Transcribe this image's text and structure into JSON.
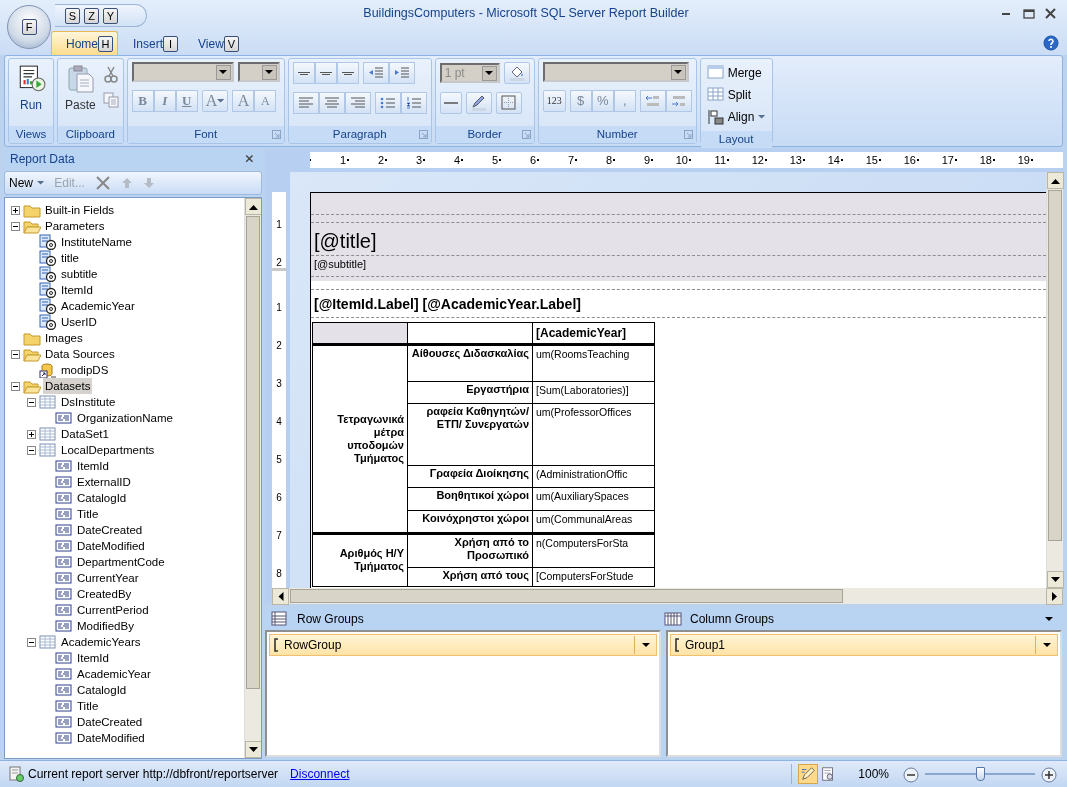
{
  "window": {
    "title": "BuildingsComputers - Microsoft SQL Server Report Builder",
    "orb_keytip": "F",
    "quick_access_keytips": [
      "S",
      "Z",
      "Y"
    ]
  },
  "tabs": [
    {
      "label": "Home",
      "keytip": "H",
      "selected": true
    },
    {
      "label": "Insert",
      "keytip": "I",
      "selected": false
    },
    {
      "label": "View",
      "keytip": "V",
      "selected": false
    }
  ],
  "ribbon": {
    "groups": [
      {
        "kind": "views",
        "label": "Views",
        "launcher": false,
        "buttons": [
          "Run"
        ]
      },
      {
        "kind": "clipboard",
        "label": "Clipboard",
        "launcher": false,
        "buttons": [
          "Paste"
        ]
      },
      {
        "kind": "font",
        "label": "Font",
        "launcher": true,
        "buttons": [
          "B",
          "I",
          "U",
          "A",
          "A",
          "A"
        ]
      },
      {
        "kind": "paragraph",
        "label": "Paragraph",
        "launcher": true
      },
      {
        "kind": "border",
        "label": "Border",
        "launcher": true,
        "combo": "1 pt"
      },
      {
        "kind": "number",
        "label": "Number",
        "launcher": true,
        "buttons": [
          "123",
          "$",
          "%",
          ","
        ]
      },
      {
        "kind": "layout",
        "label": "Layout",
        "launcher": false,
        "buttons": [
          "Merge",
          "Split",
          "Align"
        ]
      }
    ]
  },
  "report_data": {
    "title": "Report Data",
    "toolbar": [
      {
        "kind": "new",
        "label": "New",
        "disabled": false
      },
      {
        "kind": "edit",
        "label": "Edit...",
        "disabled": true
      },
      {
        "kind": "delete",
        "disabled": false
      },
      {
        "kind": "up",
        "disabled": true
      },
      {
        "kind": "down",
        "disabled": true
      }
    ],
    "tree": [
      {
        "label": "Built-in Fields",
        "kind": "folder",
        "expanded": false,
        "selected": false
      },
      {
        "label": "Parameters",
        "kind": "folder",
        "expanded": true,
        "selected": false,
        "children": [
          {
            "label": "InstituteName",
            "kind": "parameter",
            "selected": false
          },
          {
            "label": "title",
            "kind": "parameter",
            "selected": false
          },
          {
            "label": "subtitle",
            "kind": "parameter",
            "selected": false
          },
          {
            "label": "ItemId",
            "kind": "parameter",
            "selected": false
          },
          {
            "label": "AcademicYear",
            "kind": "parameter",
            "selected": false
          },
          {
            "label": "UserID",
            "kind": "parameter",
            "selected": false
          }
        ]
      },
      {
        "label": "Images",
        "kind": "folder",
        "selected": false
      },
      {
        "label": "Data Sources",
        "kind": "folder",
        "expanded": true,
        "selected": false,
        "children": [
          {
            "label": "modipDS",
            "kind": "datasource",
            "selected": false
          }
        ]
      },
      {
        "label": "Datasets",
        "kind": "folder",
        "expanded": true,
        "selected": true,
        "children": [
          {
            "label": "DsInstitute",
            "kind": "dataset",
            "expanded": true,
            "selected": false,
            "children": [
              {
                "label": "OrganizationName",
                "kind": "field",
                "selected": false
              }
            ]
          },
          {
            "label": "DataSet1",
            "kind": "dataset",
            "expanded": false,
            "selected": false
          },
          {
            "label": "LocalDepartments",
            "kind": "dataset",
            "expanded": true,
            "selected": false,
            "children": [
              {
                "label": "ItemId",
                "kind": "field",
                "selected": false
              },
              {
                "label": "ExternalID",
                "kind": "field",
                "selected": false
              },
              {
                "label": "CatalogId",
                "kind": "field",
                "selected": false
              },
              {
                "label": "Title",
                "kind": "field",
                "selected": false
              },
              {
                "label": "DateCreated",
                "kind": "field",
                "selected": false
              },
              {
                "label": "DateModified",
                "kind": "field",
                "selected": false
              },
              {
                "label": "DepartmentCode",
                "kind": "field",
                "selected": false
              },
              {
                "label": "CurrentYear",
                "kind": "field",
                "selected": false
              },
              {
                "label": "CreatedBy",
                "kind": "field",
                "selected": false
              },
              {
                "label": "CurrentPeriod",
                "kind": "field",
                "selected": false
              },
              {
                "label": "ModifiedBy",
                "kind": "field",
                "selected": false
              }
            ]
          },
          {
            "label": "AcademicYears",
            "kind": "dataset",
            "expanded": true,
            "selected": false,
            "children": [
              {
                "label": "ItemId",
                "kind": "field",
                "selected": false
              },
              {
                "label": "AcademicYear",
                "kind": "field",
                "selected": false
              },
              {
                "label": "CatalogId",
                "kind": "field",
                "selected": false
              },
              {
                "label": "Title",
                "kind": "field",
                "selected": false
              },
              {
                "label": "DateCreated",
                "kind": "field",
                "selected": false
              },
              {
                "label": "DateModified",
                "kind": "field",
                "selected": false
              }
            ]
          }
        ]
      }
    ]
  },
  "designer": {
    "ruler": {
      "horizontal": [
        "1",
        "2",
        "3",
        "4",
        "5",
        "6",
        "7",
        "8",
        "9",
        "10",
        "11",
        "12",
        "13",
        "14",
        "15",
        "16",
        "17",
        "18",
        "19"
      ],
      "vertical": [
        [
          "1",
          "2"
        ],
        [
          "1",
          "2",
          "3",
          "4",
          "5",
          "6",
          "7",
          "8"
        ]
      ]
    },
    "report": {
      "title": "[@title]",
      "subtitle": "[@subtitle]",
      "params_line": "[@ItemId.Label] [@AcademicYear.Label]",
      "tablix": {
        "column_header": "[AcademicYear]",
        "groups": [
          {
            "label": "Τετραγωνικά μέτρα υποδομών Τμήματος",
            "rows": [
              {
                "label": "Αίθουσες Διδασκαλίας",
                "value": "um(RoomsTeaching"
              },
              {
                "label": "Εργαστήρια",
                "value": "[Sum(Laboratories)]"
              },
              {
                "label": "ραφεία Καθηγητών/ ΕΤΠ/ Συνεργατών",
                "value": "um(ProfessorOffices"
              },
              {
                "label": "Γραφεία Διοίκησης",
                "value": "(AdministrationOffic"
              },
              {
                "label": "Βοηθητικοί χώροι",
                "value": "um(AuxiliarySpaces"
              },
              {
                "label": "Κοινόχρηστοι χώροι",
                "value": "um(CommunalAreas"
              }
            ]
          },
          {
            "label": "Αριθμός Η/Υ Τμήματος",
            "rows": [
              {
                "label": "Χρήση από το Προσωπικό",
                "value": "n(ComputersForSta"
              },
              {
                "label": "Χρήση από τους",
                "value": "[ComputersForStude"
              }
            ]
          }
        ]
      }
    }
  },
  "groups_pane": {
    "row_groups": {
      "title": "Row Groups",
      "items": [
        {
          "label": "RowGroup",
          "selected": true
        }
      ]
    },
    "column_groups": {
      "title": "Column Groups",
      "items": [
        {
          "label": "Group1",
          "selected": true
        }
      ]
    }
  },
  "status_bar": {
    "server_text": "Current report server http://dbfront/reportserver",
    "link": "Disconnect",
    "views": [
      {
        "kind": "design",
        "selected": true
      },
      {
        "kind": "preview",
        "selected": false
      }
    ],
    "zoom": "100%",
    "zoom_slider": {
      "level": 0.5
    }
  }
}
